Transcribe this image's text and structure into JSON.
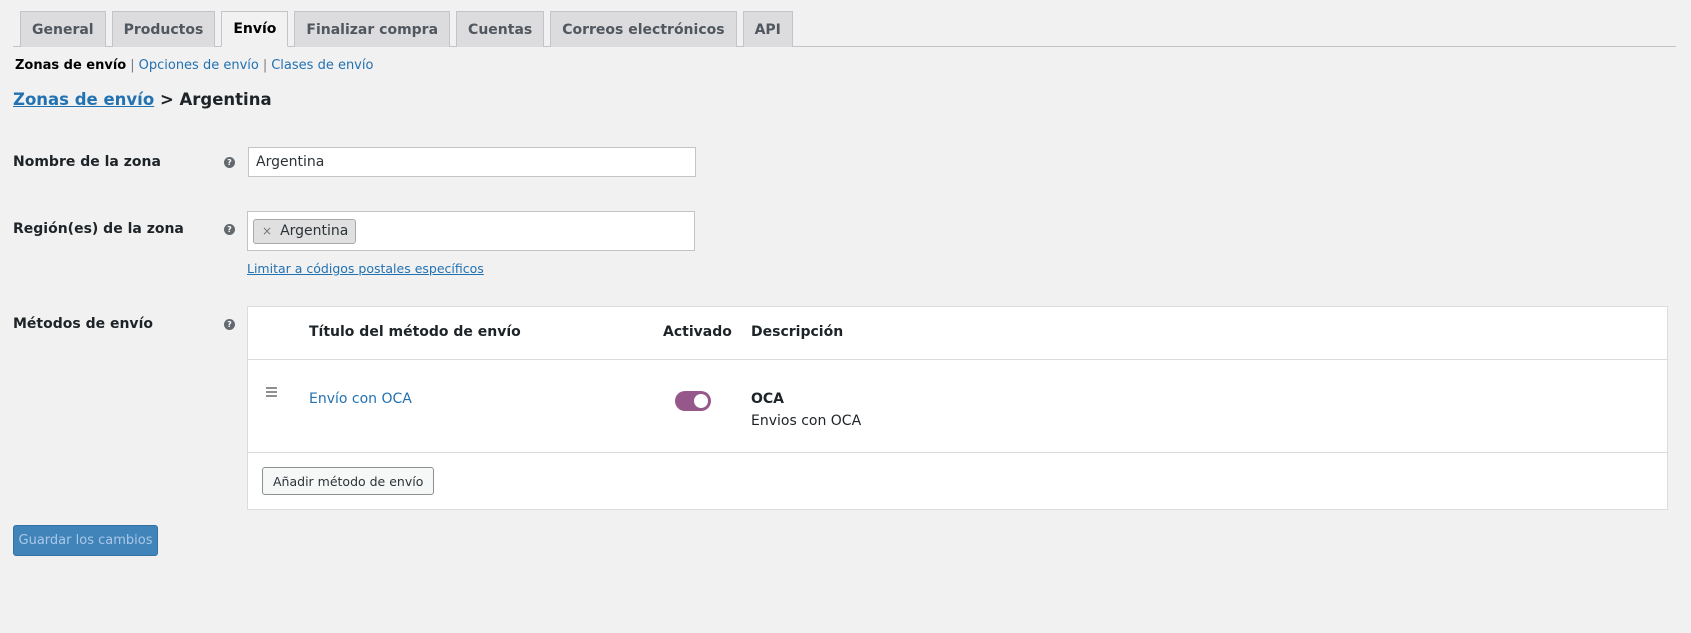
{
  "tabs": [
    {
      "label": "General"
    },
    {
      "label": "Productos"
    },
    {
      "label": "Envío"
    },
    {
      "label": "Finalizar compra"
    },
    {
      "label": "Cuentas"
    },
    {
      "label": "Correos electrónicos"
    },
    {
      "label": "API"
    }
  ],
  "active_tab": "Envío",
  "subnav": {
    "current": "Zonas de envío",
    "links": [
      "Opciones de envío",
      "Clases de envío"
    ]
  },
  "breadcrumb": {
    "link": "Zonas de envío",
    "separator": ">",
    "current": "Argentina"
  },
  "form": {
    "zone_name_label": "Nombre de la zona",
    "zone_name_value": "Argentina",
    "zone_regions_label": "Región(es) de la zona",
    "zone_region_chip": "Argentina",
    "zone_region_chip_remove": "×",
    "limit_postcodes_link": "Limitar a códigos postales específicos",
    "methods_label": "Métodos de envío",
    "help_icon": "?"
  },
  "methods_table": {
    "headers": {
      "title": "Título del método de envío",
      "enabled": "Activado",
      "description": "Descripción"
    },
    "rows": [
      {
        "title": "Envío con OCA",
        "enabled": true,
        "desc_title": "OCA",
        "desc_text": "Envios con OCA"
      }
    ],
    "add_button": "Añadir método de envío"
  },
  "save_button": "Guardar los cambios",
  "colors": {
    "accent": "#2271b1",
    "toggle_on": "#96588a",
    "background": "#f1f1f1"
  }
}
